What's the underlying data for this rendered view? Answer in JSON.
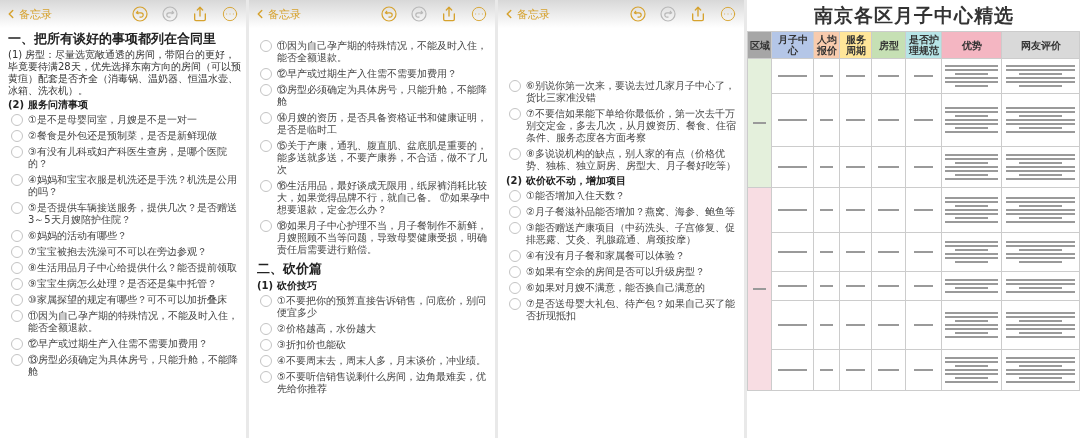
{
  "panels": [
    {
      "kind": "note",
      "nav": {
        "back_label": "备忘录",
        "redo_disabled": true
      },
      "blocks": [
        {
          "kind": "heading",
          "text": "一、把所有谈好的事项都列在合同里"
        },
        {
          "kind": "paragraph",
          "text": "(1) 房型：尽量选宽敞通透的房间，带阳台的更好，毕竟要待满28天，优先选择东南方向的房间（可以预黄疸）配套是否齐全（消毒锅、温奶器、恒温水壶、冰箱、洗衣机）。"
        },
        {
          "kind": "subheading",
          "text": "(2) 服务问清事项"
        },
        {
          "kind": "check",
          "checked": false,
          "text": "①是不是母婴同室，月嫂是不是一对一"
        },
        {
          "kind": "check",
          "checked": false,
          "text": "②餐食是外包还是预制菜，是否是新鲜现做"
        },
        {
          "kind": "check",
          "checked": false,
          "text": "③有没有儿科或妇产科医生查房，是哪个医院的？"
        },
        {
          "kind": "check",
          "checked": false,
          "text": "④妈妈和宝宝衣服是机洗还是手洗？机洗是公用的吗？"
        },
        {
          "kind": "check",
          "checked": false,
          "text": "⑤是否提供车辆接送服务，提供几次？是否赠送3～5天月嫂陪护住院？"
        },
        {
          "kind": "check",
          "checked": false,
          "text": "⑥妈妈的活动有哪些？"
        },
        {
          "kind": "check",
          "checked": false,
          "text": "⑦宝宝被抱去洗澡可不可以在旁边参观？"
        },
        {
          "kind": "check",
          "checked": false,
          "text": "⑧生活用品月子中心给提供什么？能否提前领取"
        },
        {
          "kind": "check",
          "checked": false,
          "text": "⑨宝宝生病怎么处理？是否还是集中托管？"
        },
        {
          "kind": "check",
          "checked": false,
          "text": "⑩家属探望的规定有哪些？可不可以加折叠床"
        },
        {
          "kind": "check",
          "checked": false,
          "text": "⑪因为自己孕产期的特殊情况，不能及时入住，能否全额退款。"
        },
        {
          "kind": "check",
          "checked": false,
          "text": "⑫早产或过期生产入住需不需要加费用？"
        },
        {
          "kind": "check",
          "checked": false,
          "text": "⑬房型必须确定为具体房号，只能升舱，不能降舱"
        }
      ]
    },
    {
      "kind": "note",
      "nav": {
        "back_label": "备忘录",
        "redo_disabled": true
      },
      "blocks": [
        {
          "kind": "check",
          "checked": false,
          "text": "⑪因为自己孕产期的特殊情况，不能及时入住，能否全额退款。"
        },
        {
          "kind": "check",
          "checked": false,
          "text": "⑫早产或过期生产入住需不需要加费用？"
        },
        {
          "kind": "check",
          "checked": false,
          "text": "⑬房型必须确定为具体房号，只能升舱，不能降舱"
        },
        {
          "kind": "check",
          "checked": false,
          "text": "⑭月嫂的资历，是否具备资格证书和健康证明，是否是临时工"
        },
        {
          "kind": "check",
          "checked": false,
          "text": "⑮关于产康，通乳、腹直肌、盆底肌是重要的，能多送就多送，不要产康券，不合适，做不了几次"
        },
        {
          "kind": "check",
          "checked": false,
          "text": "⑯生活用品，最好谈成无限用，纸尿裤消耗比较大，如果觉得品牌不行，就自己备。 ⑰如果孕中想要退款，定金怎么办？"
        },
        {
          "kind": "check",
          "checked": false,
          "text": "⑱如果月子中心护理不当，月子餐制作不新鲜，月嫂照顾不当等问题，导致母婴健康受损，明确责任后需要进行赔偿。"
        },
        {
          "kind": "heading",
          "text": "二、砍价篇"
        },
        {
          "kind": "subheading",
          "text": "(1) 砍价技巧"
        },
        {
          "kind": "check",
          "checked": false,
          "text": "①不要把你的预算直接告诉销售，问底价，别问便宜多少"
        },
        {
          "kind": "check",
          "checked": false,
          "text": "②价格越高，水份越大"
        },
        {
          "kind": "check",
          "checked": false,
          "text": "③折扣价也能砍"
        },
        {
          "kind": "check",
          "checked": false,
          "text": "④不要周末去，周末人多，月末谈价，冲业绩。"
        },
        {
          "kind": "check",
          "checked": false,
          "text": "⑤不要听信销售说剩什么房间，边角最难卖，优先给你推荐"
        }
      ]
    },
    {
      "kind": "note",
      "nav": {
        "back_label": "备忘录",
        "redo_disabled": true
      },
      "blocks": [
        {
          "kind": "check",
          "checked": false,
          "text": "⑥别说你第一次来，要说去过几家月子中心了，货比三家准没错"
        },
        {
          "kind": "check",
          "checked": false,
          "text": "⑦不要信如果能下单给你最低价，第一次去千万别交定金，多去几次，从月嫂资历、餐食、住宿条件、服务态度各方面考察"
        },
        {
          "kind": "check",
          "checked": false,
          "text": "⑧多说说机构的缺点，别人家的有点（价格优势、独栋、独立厨房、房型大、月子餐好吃等）"
        },
        {
          "kind": "subheading",
          "text": "(2) 砍价砍不动，增加项目"
        },
        {
          "kind": "check",
          "checked": false,
          "text": "①能否增加入住天数？"
        },
        {
          "kind": "check",
          "checked": false,
          "text": "②月子餐滋补品能否增加？燕窝、海参、鲍鱼等"
        },
        {
          "kind": "check",
          "checked": false,
          "text": "③能否赠送产康项目（中药洗头、子宫修复、促排恶露、艾灸、乳腺疏通、肩颈按摩）"
        },
        {
          "kind": "check",
          "checked": false,
          "text": "④有没有月子餐和家属餐可以体验？"
        },
        {
          "kind": "check",
          "checked": false,
          "text": "⑤如果有空余的房间是否可以升级房型？"
        },
        {
          "kind": "check",
          "checked": false,
          "text": "⑥如果对月嫂不满意，能否换自己满意的"
        },
        {
          "kind": "check",
          "checked": false,
          "text": "⑦是否送母婴大礼包、待产包？如果自己买了能否折现抵扣"
        }
      ]
    },
    {
      "kind": "sheet",
      "title": "南京各区月子中心精选",
      "columns": [
        {
          "label": "区域",
          "color": "#a6a6a6"
        },
        {
          "label": "月子中心",
          "color": "#b4c6e7"
        },
        {
          "label": "人均报价",
          "color": "#f8cbad"
        },
        {
          "label": "服务周期",
          "color": "#ffe699"
        },
        {
          "label": "房型",
          "color": "#c6e0b4"
        },
        {
          "label": "是否护理规范",
          "color": "#b7e4e6"
        },
        {
          "label": "优势",
          "color": "#f4b6c2"
        },
        {
          "label": "网友评价",
          "color": "#d9d9d9"
        }
      ],
      "regions": [
        {
          "color": "#e4f0dc"
        },
        {
          "color": "#f8dde3"
        }
      ]
    }
  ]
}
